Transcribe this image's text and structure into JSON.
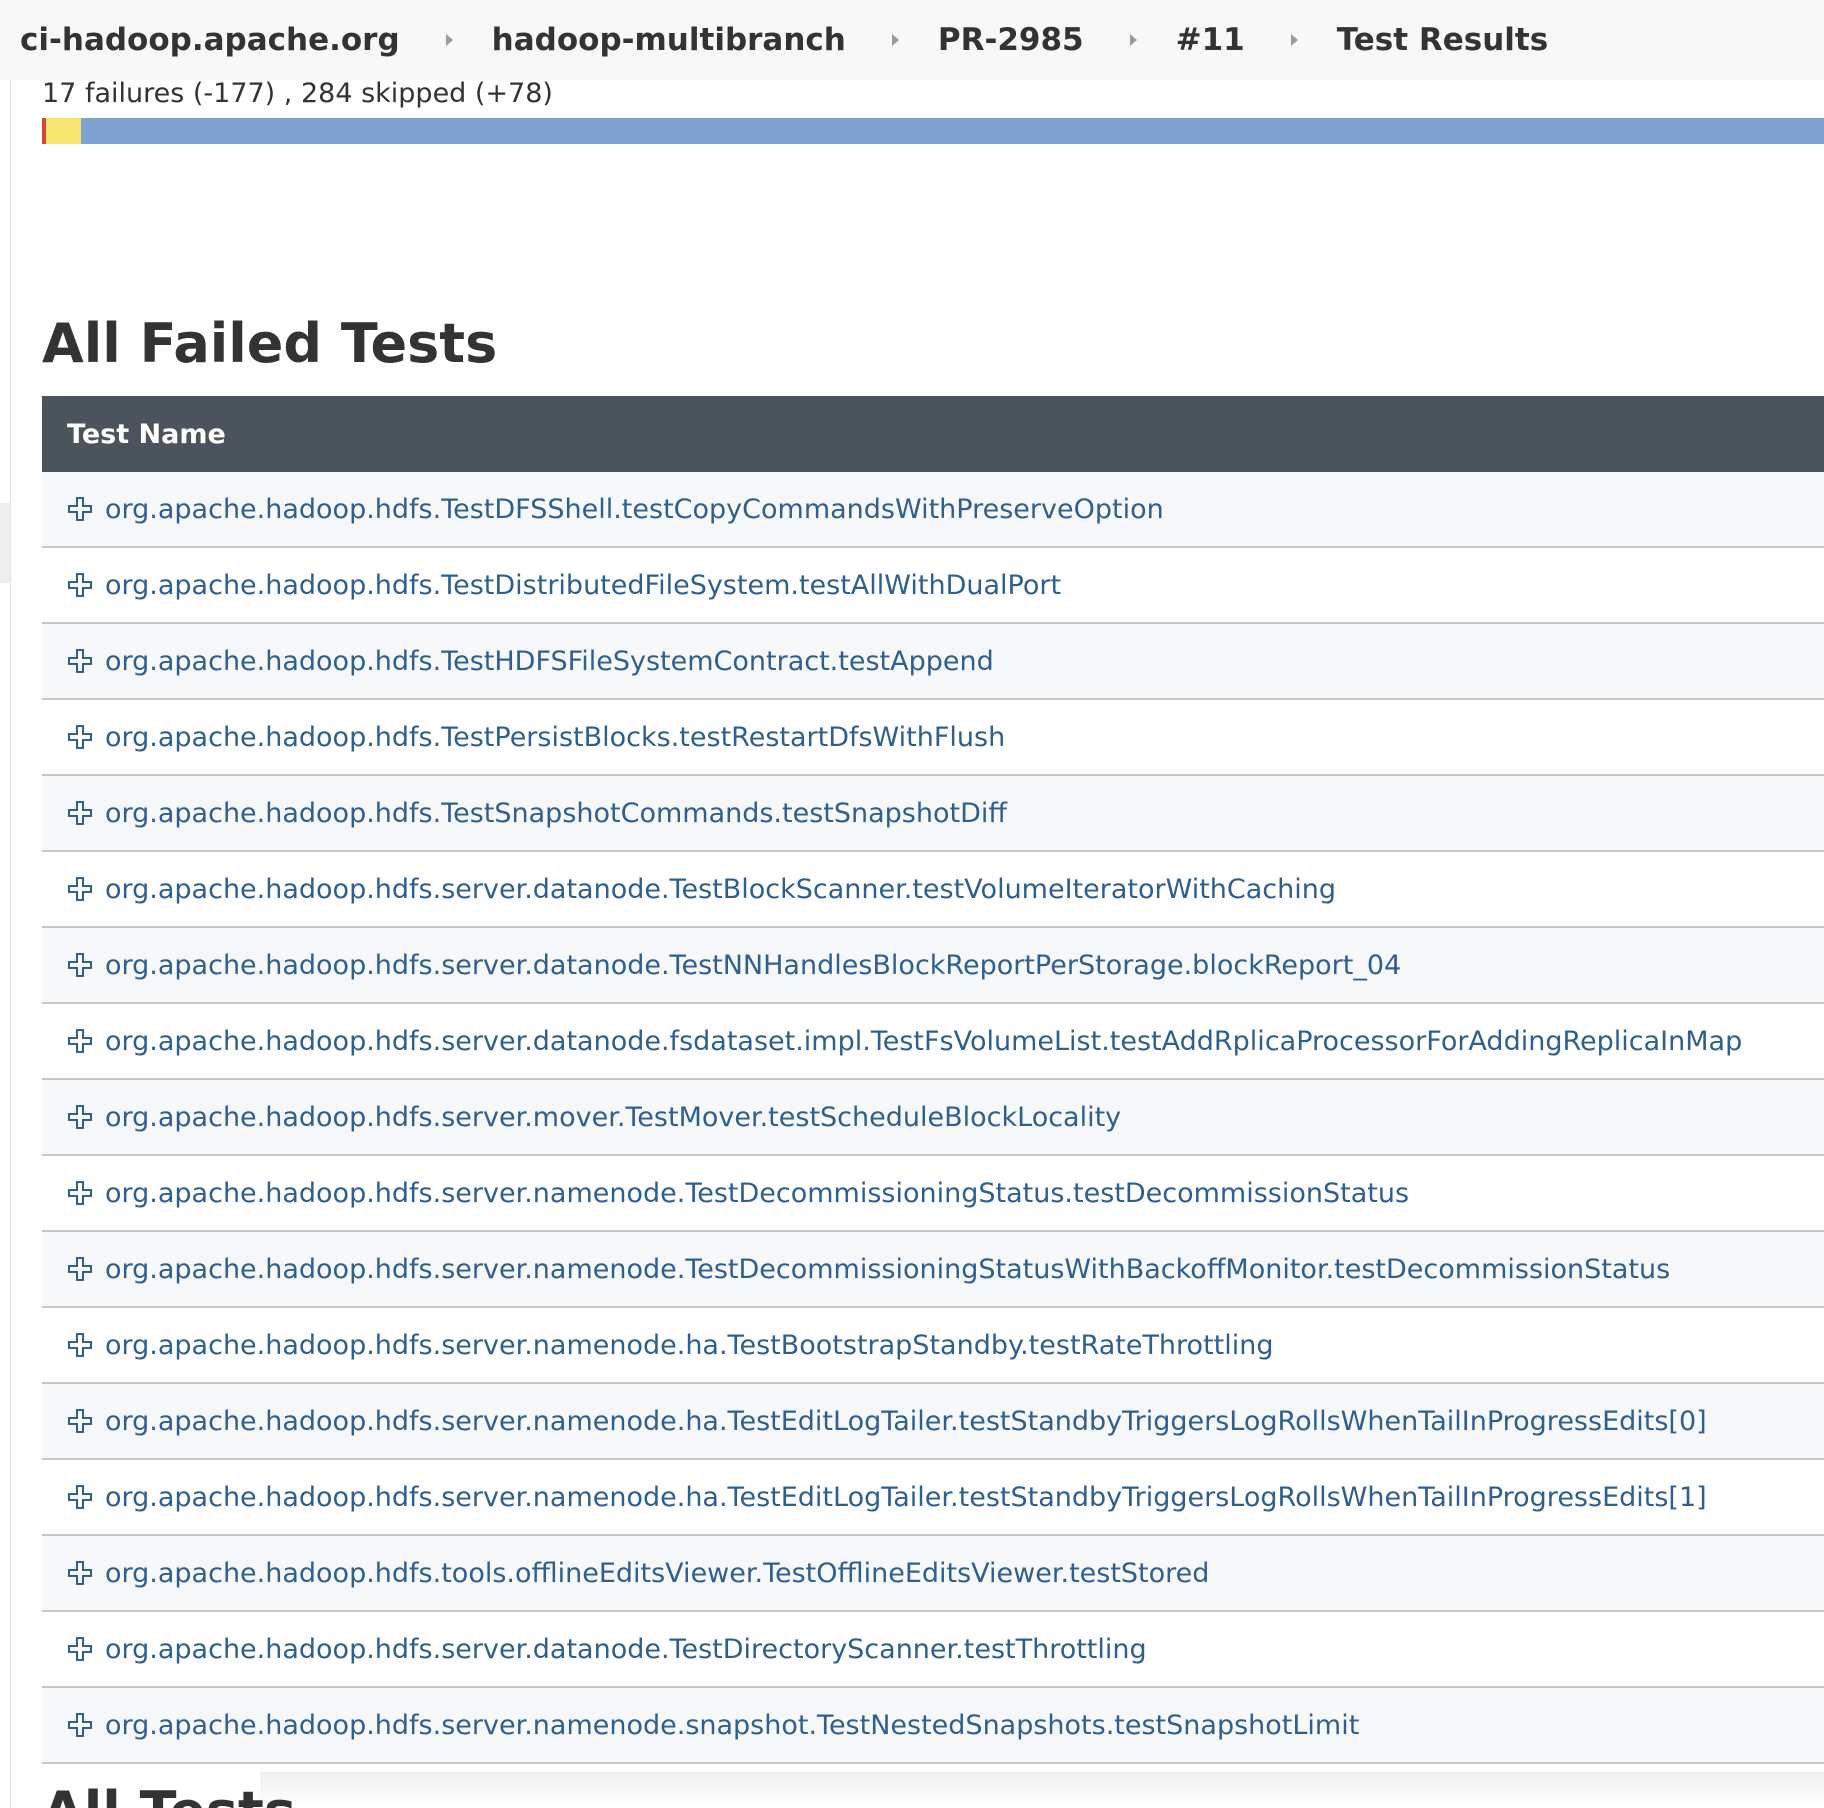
{
  "breadcrumb": {
    "items": [
      {
        "label": "ci-hadoop.apache.org"
      },
      {
        "label": "hadoop-multibranch"
      },
      {
        "label": "PR-2985"
      },
      {
        "label": "#11"
      },
      {
        "label": "Test Results"
      }
    ]
  },
  "summary": {
    "text": "17 failures (-177) , 284 skipped (+78)",
    "bar": {
      "fail_fraction": 0.002,
      "skip_fraction": 0.02,
      "colors": {
        "fail": "#d24939",
        "skip": "#f6e56e",
        "pass": "#7ea3d1"
      }
    }
  },
  "failed_section": {
    "title": "All Failed Tests",
    "column_header": "Test Name",
    "rows": [
      {
        "name": "org.apache.hadoop.hdfs.TestDFSShell.testCopyCommandsWithPreserveOption"
      },
      {
        "name": "org.apache.hadoop.hdfs.TestDistributedFileSystem.testAllWithDualPort"
      },
      {
        "name": "org.apache.hadoop.hdfs.TestHDFSFileSystemContract.testAppend"
      },
      {
        "name": "org.apache.hadoop.hdfs.TestPersistBlocks.testRestartDfsWithFlush"
      },
      {
        "name": "org.apache.hadoop.hdfs.TestSnapshotCommands.testSnapshotDiff"
      },
      {
        "name": "org.apache.hadoop.hdfs.server.datanode.TestBlockScanner.testVolumeIteratorWithCaching"
      },
      {
        "name": "org.apache.hadoop.hdfs.server.datanode.TestNNHandlesBlockReportPerStorage.blockReport_04"
      },
      {
        "name": "org.apache.hadoop.hdfs.server.datanode.fsdataset.impl.TestFsVolumeList.testAddRplicaProcessorForAddingReplicaInMap"
      },
      {
        "name": "org.apache.hadoop.hdfs.server.mover.TestMover.testScheduleBlockLocality"
      },
      {
        "name": "org.apache.hadoop.hdfs.server.namenode.TestDecommissioningStatus.testDecommissionStatus"
      },
      {
        "name": "org.apache.hadoop.hdfs.server.namenode.TestDecommissioningStatusWithBackoffMonitor.testDecommissionStatus"
      },
      {
        "name": "org.apache.hadoop.hdfs.server.namenode.ha.TestBootstrapStandby.testRateThrottling"
      },
      {
        "name": "org.apache.hadoop.hdfs.server.namenode.ha.TestEditLogTailer.testStandbyTriggersLogRollsWhenTailInProgressEdits[0]"
      },
      {
        "name": "org.apache.hadoop.hdfs.server.namenode.ha.TestEditLogTailer.testStandbyTriggersLogRollsWhenTailInProgressEdits[1]"
      },
      {
        "name": "org.apache.hadoop.hdfs.tools.offlineEditsViewer.TestOfflineEditsViewer.testStored"
      },
      {
        "name": "org.apache.hadoop.hdfs.server.datanode.TestDirectoryScanner.testThrottling"
      },
      {
        "name": "org.apache.hadoop.hdfs.server.namenode.snapshot.TestNestedSnapshots.testSnapshotLimit"
      }
    ]
  },
  "next_section": {
    "title": "All Tests"
  },
  "icons": {
    "row_expand": "plus-expand-icon",
    "breadcrumb_separator": "chevron-right-icon"
  }
}
